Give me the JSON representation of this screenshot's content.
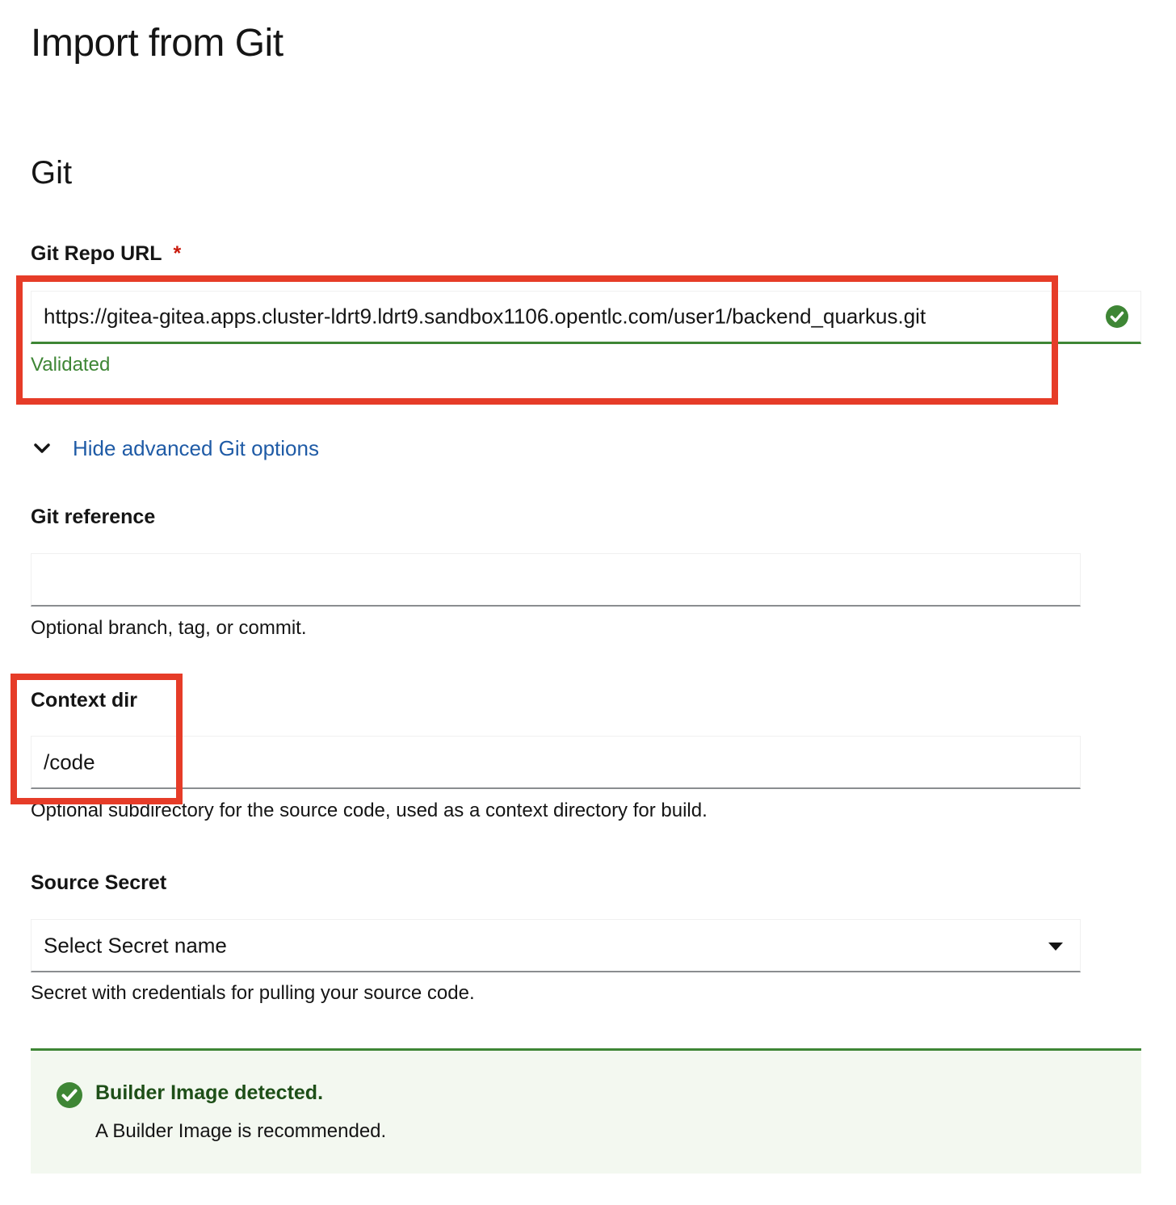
{
  "page": {
    "title": "Import from Git"
  },
  "git_section": {
    "title": "Git",
    "repo_url": {
      "label": "Git Repo URL",
      "required_marker": "*",
      "value": "https://gitea-gitea.apps.cluster-ldrt9.ldrt9.sandbox1106.opentlc.com/user1/backend_quarkus.git",
      "status_icon": "check-circle-icon",
      "status_text": "Validated"
    },
    "advanced_toggle": {
      "icon": "chevron-down-icon",
      "label": "Hide advanced Git options"
    },
    "git_reference": {
      "label": "Git reference",
      "value": "",
      "helper": "Optional branch, tag, or commit."
    },
    "context_dir": {
      "label": "Context dir",
      "value": "/code",
      "helper": "Optional subdirectory for the source code, used as a context directory for build."
    },
    "source_secret": {
      "label": "Source Secret",
      "selected": "Select Secret name",
      "dropdown_icon": "caret-down-icon",
      "helper": "Secret with credentials for pulling your source code."
    }
  },
  "alert": {
    "icon": "check-circle-icon",
    "title": "Builder Image detected.",
    "description": "A Builder Image is recommended."
  },
  "colors": {
    "success": "#3e8635",
    "link": "#1f5ba6",
    "highlight": "#e63c28",
    "required": "#c9190b",
    "alert_background": "#f3f8f0"
  }
}
